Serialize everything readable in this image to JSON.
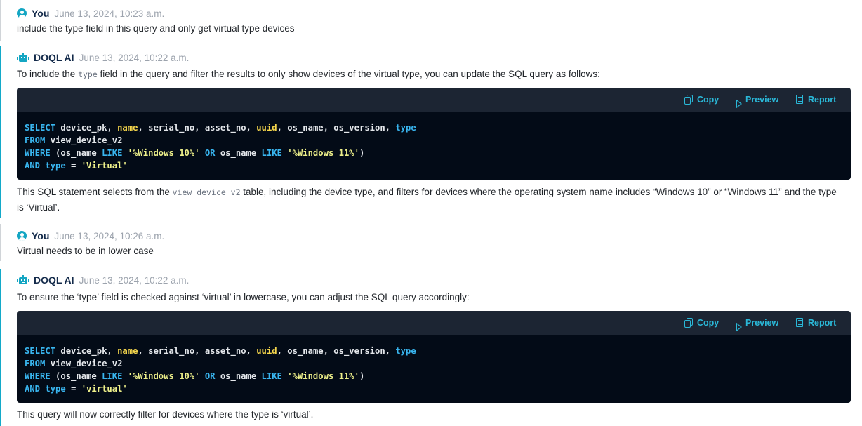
{
  "messages": [
    {
      "author": "You",
      "timestamp": "June 13, 2024, 10:23 a.m.",
      "text": "include the type field in this query and only get virtual type devices"
    },
    {
      "author": "DOQL AI",
      "timestamp": "June 13, 2024, 10:22 a.m.",
      "intro_before_code": "To include the ",
      "intro_code": "type",
      "intro_after_code": " field in the query and filter the results to only show devices of the virtual type, you can update the SQL query as follows:",
      "toolbar": {
        "copy": "Copy",
        "preview": "Preview",
        "report": "Report"
      },
      "sql": {
        "l1_kw1": "SELECT",
        "l1_a": " device_pk, ",
        "l1_name": "name",
        "l1_b": ", serial_no, asset_no, ",
        "l1_uuid": "uuid",
        "l1_c": ", os_name, os_version, ",
        "l1_type": "type",
        "l2_kw": "FROM",
        "l2_a": " view_device_v2",
        "l3_kw": "WHERE",
        "l3_a": " (os_name ",
        "l3_like1": "LIKE",
        "l3_s1": " '%Windows 10%'",
        "l3_or": " OR",
        "l3_b": " os_name ",
        "l3_like2": "LIKE",
        "l3_s2": " '%Windows 11%'",
        "l3_c": ")",
        "l4_and": "AND",
        "l4_type": " type",
        "l4_eq": " = ",
        "l4_val": "'Virtual'"
      },
      "outro_before_code": "This SQL statement selects from the ",
      "outro_code": "view_device_v2",
      "outro_after_code": " table, including the device type, and filters for devices where the operating system name includes “Windows 10” or “Windows 11” and the type is ‘Virtual’."
    },
    {
      "author": "You",
      "timestamp": "June 13, 2024, 10:26 a.m.",
      "text": "Virtual needs to be in lower case"
    },
    {
      "author": "DOQL AI",
      "timestamp": "June 13, 2024, 10:22 a.m.",
      "intro": "To ensure the ‘type’ field is checked against ‘virtual’ in lowercase, you can adjust the SQL query accordingly:",
      "toolbar": {
        "copy": "Copy",
        "preview": "Preview",
        "report": "Report"
      },
      "sql": {
        "l1_kw1": "SELECT",
        "l1_a": " device_pk, ",
        "l1_name": "name",
        "l1_b": ", serial_no, asset_no, ",
        "l1_uuid": "uuid",
        "l1_c": ", os_name, os_version, ",
        "l1_type": "type",
        "l2_kw": "FROM",
        "l2_a": " view_device_v2",
        "l3_kw": "WHERE",
        "l3_a": " (os_name ",
        "l3_like1": "LIKE",
        "l3_s1": " '%Windows 10%'",
        "l3_or": " OR",
        "l3_b": " os_name ",
        "l3_like2": "LIKE",
        "l3_s2": " '%Windows 11%'",
        "l3_c": ")",
        "l4_and": "AND",
        "l4_type": " type",
        "l4_eq": " = ",
        "l4_val": "'virtual'"
      },
      "outro": "This query will now correctly filter for devices where the type is ‘virtual’."
    }
  ],
  "colors": {
    "accent": "#13a9c9",
    "user_bar": "#d0d4d8",
    "code_bg": "#030b17",
    "toolbar_bg": "#1c2533",
    "keyword": "#39b6f0",
    "string": "#eef08a"
  },
  "icons": [
    "user-avatar-icon",
    "bot-icon",
    "copy-icon",
    "play-icon",
    "report-icon"
  ]
}
